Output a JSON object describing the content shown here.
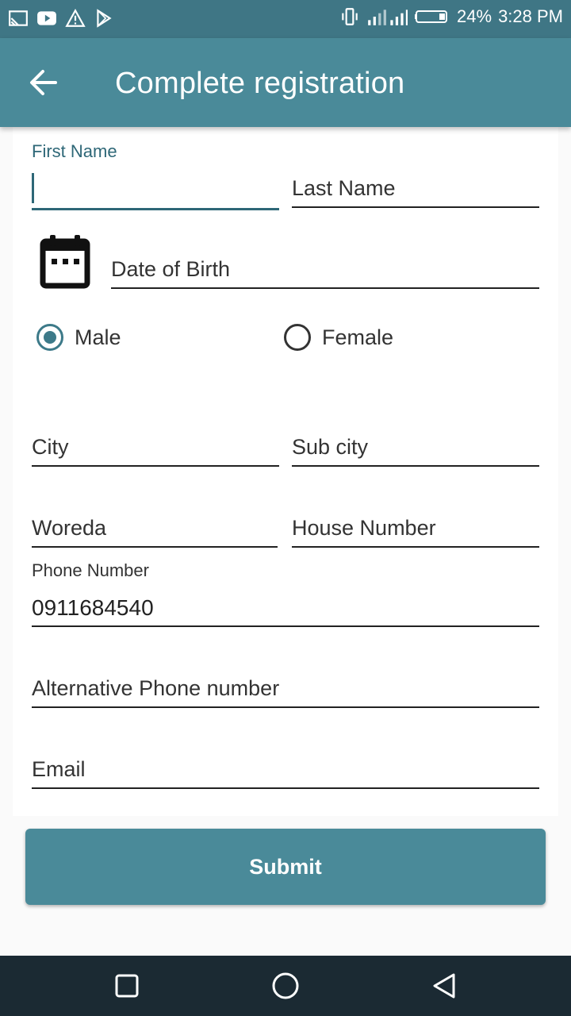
{
  "status_bar": {
    "battery": "24%",
    "time": "3:28 PM"
  },
  "header": {
    "title": "Complete registration"
  },
  "form": {
    "first_name_label": "First Name",
    "last_name_label": "Last Name",
    "dob_label": "Date of Birth",
    "gender_male": "Male",
    "gender_female": "Female",
    "gender_selected": "Male",
    "city_label": "City",
    "sub_city_label": "Sub city",
    "woreda_label": "Woreda",
    "house_number_label": "House Number",
    "phone_label": "Phone Number",
    "phone_value": "0911684540",
    "alt_phone_label": "Alternative Phone number",
    "email_label": "Email"
  },
  "actions": {
    "submit_label": "Submit"
  },
  "colors": {
    "primary": "#4a8a99",
    "status_bar": "#3f7685",
    "accent": "#2e6777",
    "nav_bar": "#1b2a33"
  }
}
